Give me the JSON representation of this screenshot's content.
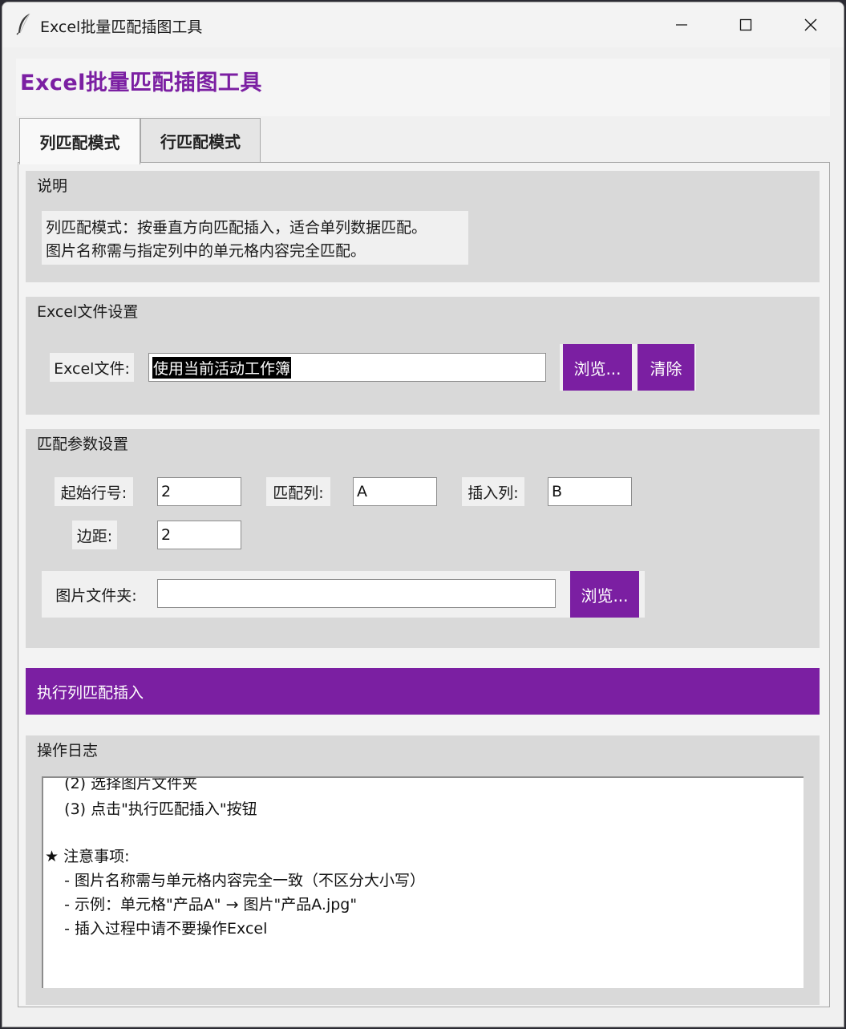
{
  "window": {
    "title": "Excel批量匹配插图工具"
  },
  "header": {
    "title": "Excel批量匹配插图工具",
    "accent_color": "#7b1fa2"
  },
  "tabs": [
    {
      "label": "列匹配模式",
      "selected": true
    },
    {
      "label": "行匹配模式",
      "selected": false
    }
  ],
  "description": {
    "title": "说明",
    "lines": [
      "列匹配模式：按垂直方向匹配插入，适合单列数据匹配。",
      "图片名称需与指定列中的单元格内容完全匹配。"
    ]
  },
  "excel_settings": {
    "title": "Excel文件设置",
    "file_label": "Excel文件:",
    "file_value": "使用当前活动工作簿",
    "browse_label": "浏览...",
    "clear_label": "清除"
  },
  "params": {
    "title": "匹配参数设置",
    "start_row_label": "起始行号:",
    "start_row_value": "2",
    "match_col_label": "匹配列:",
    "match_col_value": "A",
    "insert_col_label": "插入列:",
    "insert_col_value": "B",
    "margin_label": "边距:",
    "margin_value": "2",
    "folder_label": "图片文件夹:",
    "folder_value": "",
    "browse_label": "浏览..."
  },
  "run_button": {
    "label": "执行列匹配插入"
  },
  "log": {
    "title": "操作日志",
    "lines": [
      "    (2) 选择图片文件夹",
      "    (3) 点击\"执行匹配插入\"按钮",
      "",
      "★ 注意事项:",
      "    - 图片名称需与单元格内容完全一致（不区分大小写）",
      "    - 示例：单元格\"产品A\" → 图片\"产品A.jpg\"",
      "    - 插入过程中请不要操作Excel"
    ]
  }
}
